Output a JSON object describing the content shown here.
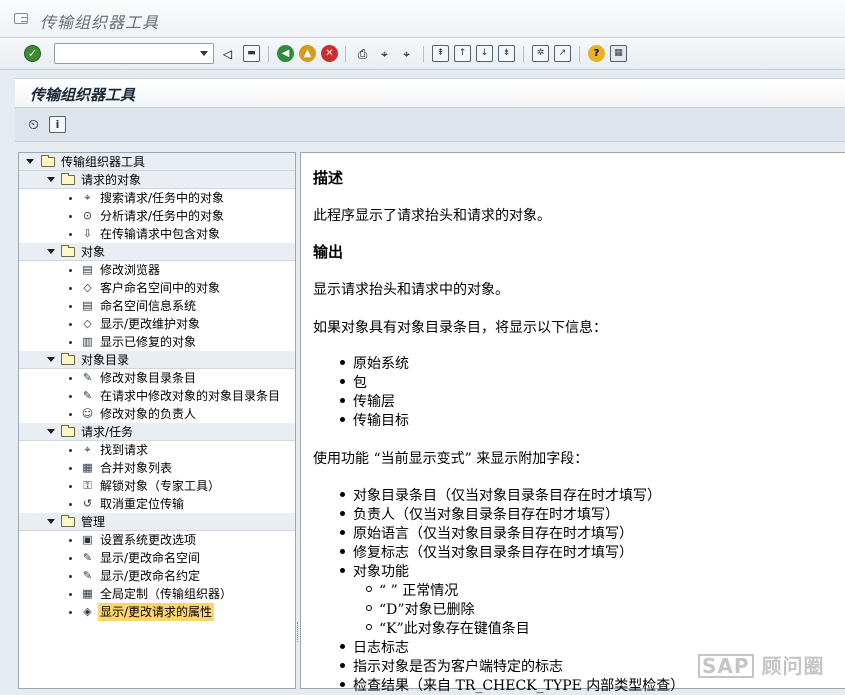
{
  "window": {
    "title": "传输组织器工具"
  },
  "toolbar": {
    "command_field_value": "",
    "icons": [
      "enter-icon",
      "command-dropdown-icon",
      "back-arrow-icon",
      "save-icon",
      "back-icon",
      "exit-icon",
      "cancel-icon",
      "print-icon",
      "find-icon",
      "find-next-icon",
      "first-page-icon",
      "previous-page-icon",
      "next-page-icon",
      "last-page-icon",
      "create-session-icon",
      "shortcut-icon",
      "help-icon",
      "layout-icon"
    ]
  },
  "app_header": {
    "title": "传输组织器工具"
  },
  "app_toolbar": {
    "icons": [
      "execute-icon",
      "information-icon"
    ]
  },
  "tree": {
    "root": "传输组织器工具",
    "groups": [
      {
        "label": "请求的对象",
        "items": [
          {
            "label": "搜索请求/任务中的对象",
            "icon": "binoculars-icon"
          },
          {
            "label": "分析请求/任务中的对象",
            "icon": "analysis-icon"
          },
          {
            "label": "在传输请求中包含对象",
            "icon": "include-object-icon"
          }
        ]
      },
      {
        "label": "对象",
        "items": [
          {
            "label": "修改浏览器",
            "icon": "browser-icon"
          },
          {
            "label": "客户命名空间中的对象",
            "icon": "namespace-icon"
          },
          {
            "label": "命名空间信息系统",
            "icon": "info-system-icon"
          },
          {
            "label": "显示/更改维护对象",
            "icon": "maintenance-object-icon"
          },
          {
            "label": "显示已修复的对象",
            "icon": "repaired-object-icon"
          }
        ]
      },
      {
        "label": "对象目录",
        "items": [
          {
            "label": "修改对象目录条目",
            "icon": "pencil-icon"
          },
          {
            "label": "在请求中修改对象的对象目录条目",
            "icon": "pencil-icon"
          },
          {
            "label": "修改对象的负责人",
            "icon": "people-icon"
          }
        ]
      },
      {
        "label": "请求/任务",
        "items": [
          {
            "label": "找到请求",
            "icon": "binoculars-icon"
          },
          {
            "label": "合并对象列表",
            "icon": "merge-list-icon"
          },
          {
            "label": "解锁对象（专家工具）",
            "icon": "unlock-icon"
          },
          {
            "label": "取消重定位传输",
            "icon": "undo-transport-icon"
          }
        ]
      },
      {
        "label": "管理",
        "items": [
          {
            "label": "设置系统更改选项",
            "icon": "system-settings-icon"
          },
          {
            "label": "显示/更改命名空间",
            "icon": "pencil-icon"
          },
          {
            "label": "显示/更改命名约定",
            "icon": "pencil-icon"
          },
          {
            "label": "全局定制（传输组织器）",
            "icon": "table-icon"
          },
          {
            "label": "显示/更改请求的属性",
            "icon": "tag-icon",
            "selected": true
          }
        ]
      }
    ]
  },
  "doc": {
    "h_desc": "描述",
    "p1": "此程序显示了请求抬头和请求的对象。",
    "h_output": "输出",
    "p2": "显示请求抬头和请求中的对象。",
    "p3": "如果对象具有对象目录条目，将显示以下信息：",
    "list1": [
      "原始系统",
      "包",
      "传输层",
      "传输目标"
    ],
    "p4": "使用功能 “当前显示变式” 来显示附加字段：",
    "list2": [
      "对象目录条目（仅当对象目录条目存在时才填写）",
      "负责人（仅当对象目录条目存在时才填写）",
      "原始语言（仅当对象目录条目存在时才填写）",
      "修复标志（仅当对象目录条目存在时才填写）",
      "对象功能"
    ],
    "sublist": [
      "“ ” 正常情况",
      "“D”对象已删除",
      "“K”此对象存在键值条目"
    ],
    "list3": [
      "日志标志",
      "指示对象是否为客户端特定的标志",
      "检查结果（来自 TR_CHECK_TYPE 内部类型检查）"
    ]
  },
  "watermark": {
    "brand": "SAP",
    "text": "顾问圈"
  }
}
